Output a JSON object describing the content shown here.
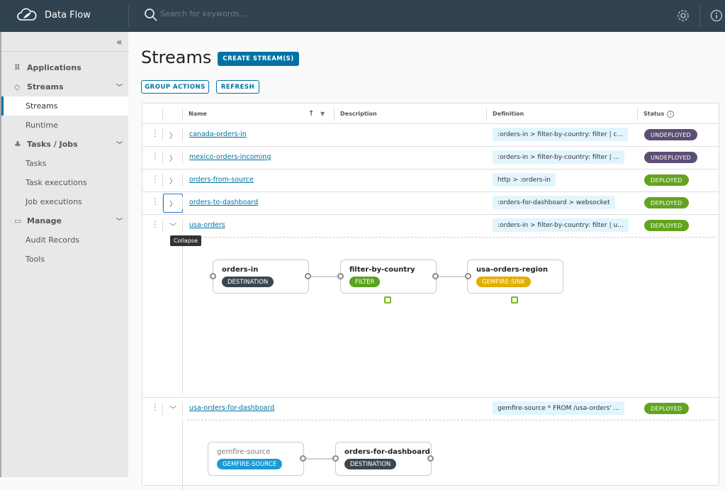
{
  "header": {
    "brand": "Data Flow",
    "search_placeholder": "Search for keywords..."
  },
  "sidebar": {
    "items": [
      {
        "label": "Applications",
        "type": "group",
        "icon": "grid-icon"
      },
      {
        "label": "Streams",
        "type": "group",
        "icon": "streams-icon"
      },
      {
        "label": "Streams",
        "type": "item",
        "active": true
      },
      {
        "label": "Runtime",
        "type": "item"
      },
      {
        "label": "Tasks / Jobs",
        "type": "group",
        "icon": "tasks-icon"
      },
      {
        "label": "Tasks",
        "type": "item"
      },
      {
        "label": "Task executions",
        "type": "item"
      },
      {
        "label": "Job executions",
        "type": "item"
      },
      {
        "label": "Manage",
        "type": "group",
        "icon": "briefcase-icon"
      },
      {
        "label": "Audit Records",
        "type": "item"
      },
      {
        "label": "Tools",
        "type": "item"
      }
    ]
  },
  "page": {
    "title": "Streams",
    "create_label": "CREATE STREAM(S)",
    "group_actions_label": "GROUP ACTIONS",
    "refresh_label": "REFRESH",
    "tooltip": "Collapse"
  },
  "table": {
    "columns": {
      "name": "Name",
      "description": "Description",
      "definition": "Definition",
      "status": "Status"
    },
    "rows": [
      {
        "name": "canada-orders-in",
        "definition": ":orders-in > filter-by-country: filter | c...",
        "status": "UNDEPLOYED"
      },
      {
        "name": "mexico-orders-incoming",
        "definition": ":orders-in > filter-by-country: filter | ...",
        "status": "UNDEPLOYED"
      },
      {
        "name": "orders-from-source",
        "definition": "http > :orders-in",
        "status": "DEPLOYED"
      },
      {
        "name": "orders-to-dashboard",
        "definition": ":orders-for-dashboard > websocket",
        "status": "DEPLOYED"
      },
      {
        "name": "usa-orders",
        "definition": ":orders-in > filter-by-country: filter | u...",
        "status": "DEPLOYED"
      },
      {
        "name": "usa-orders-for-dashboard",
        "definition": "gemfire-source * FROM /usa-orders' ...",
        "status": "DEPLOYED"
      }
    ]
  },
  "graph1": [
    {
      "name": "orders-in",
      "type": "DESTINATION"
    },
    {
      "name": "filter-by-country",
      "type": "FILTER"
    },
    {
      "name": "usa-orders-region",
      "type": "GEMFIRE-SINK"
    }
  ],
  "graph2": [
    {
      "name": "gemfire-source",
      "type": "GEMFIRE-SOURCE"
    },
    {
      "name": "orders-for-dashboard",
      "type": "DESTINATION"
    }
  ],
  "colors": {
    "header": "#314351",
    "accent": "#0072a3",
    "undeployed": "#5c4e75",
    "deployed": "#62a420",
    "destination": "#3b474f",
    "filter": "#5aa220",
    "gemfire_sink": "#e3ac00",
    "gemfire_source": "#1b9ad6"
  }
}
